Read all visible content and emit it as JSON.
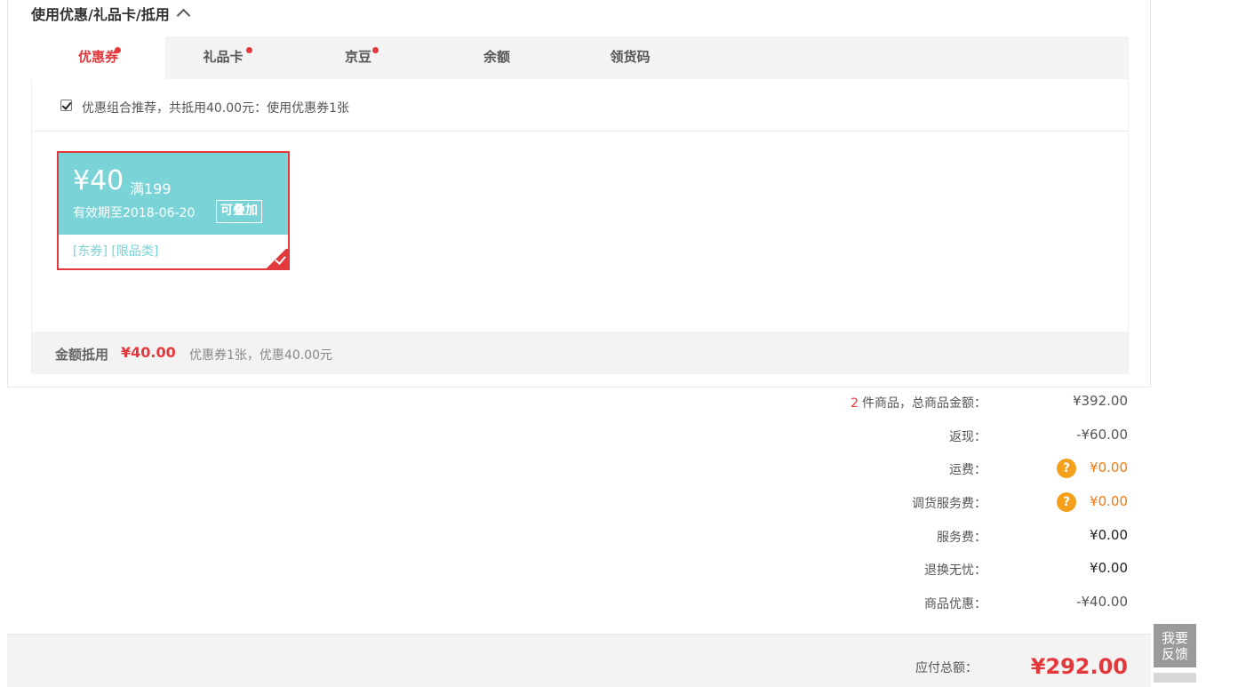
{
  "section": {
    "title": "使用优惠/礼品卡/抵用"
  },
  "tabs": [
    {
      "label": "优惠券",
      "active": true,
      "dot": true
    },
    {
      "label": "礼品卡",
      "active": false,
      "dot": true
    },
    {
      "label": "京豆",
      "active": false,
      "dot": true
    },
    {
      "label": "余额",
      "active": false,
      "dot": false
    },
    {
      "label": "领货码",
      "active": false,
      "dot": false
    }
  ],
  "combo": {
    "checked": true,
    "label": "优惠组合推荐，共抵用40.00元：使用优惠券1张"
  },
  "coupon": {
    "amount": "¥40",
    "threshold": "满199",
    "expiry": "有效期至2018-06-20",
    "stack_badge": "可叠加",
    "tags": "[东券]  [限品类]",
    "selected": true,
    "color": "#7ad3d6"
  },
  "summary": {
    "label": "金额抵用",
    "amount": "¥40.00",
    "desc": "优惠券1张，优惠40.00元"
  },
  "totals": {
    "count": "2",
    "count_suffix": "件商品，总商品金额：",
    "goods_value": "¥392.00",
    "rows": [
      {
        "label": "返现：",
        "value": "-¥60.00"
      },
      {
        "label": "运费：",
        "value": "¥0.00",
        "help": "?"
      },
      {
        "label": "调货服务费：",
        "value": "¥0.00",
        "help": "?"
      },
      {
        "label": "服务费：",
        "value": "¥0.00"
      },
      {
        "label": "退换无忧：",
        "value": "¥0.00"
      },
      {
        "label": "商品优惠：",
        "value": "-¥40.00"
      }
    ]
  },
  "pay": {
    "label": "应付总额：",
    "value": "¥292.00"
  },
  "feedback": {
    "line1": "我要",
    "line2": "反馈"
  },
  "colors": {
    "accent": "#e4393c",
    "coupon": "#7ad3d6",
    "help": "#f5a01b",
    "fee": "#f07a10"
  }
}
